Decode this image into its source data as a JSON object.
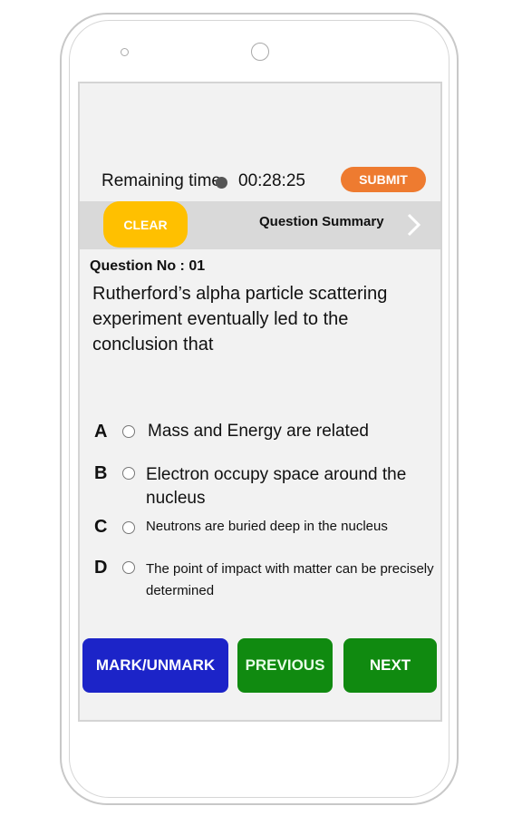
{
  "header": {
    "remaining_time_label": "Remaining time",
    "time_value": "00:28:25",
    "submit_label": "SUBMIT"
  },
  "bar": {
    "clear_label": "CLEAR",
    "summary_label": "Question Summary"
  },
  "question": {
    "number_label": "Question No : 01",
    "text": "Rutherford’s alpha particle scattering experiment eventually led to the conclusion that"
  },
  "options": [
    {
      "letter": "A",
      "text": "Mass and Energy are related"
    },
    {
      "letter": "B",
      "text": "Electron occupy space around the nucleus"
    },
    {
      "letter": "C",
      "text": "Neutrons are buried deep in the nucleus"
    },
    {
      "letter": "D",
      "text": "The point of impact with matter can be precisely determined"
    }
  ],
  "footer": {
    "mark_label": "MARK/UNMARK",
    "previous_label": "PREVIOUS",
    "next_label": "NEXT"
  },
  "colors": {
    "submit": "#ee7b30",
    "clear": "#ffc000",
    "mark": "#1c24c8",
    "nav": "#108a10"
  },
  "icons": {
    "clock": "clock-icon",
    "chevron": "chevron-right-icon"
  }
}
